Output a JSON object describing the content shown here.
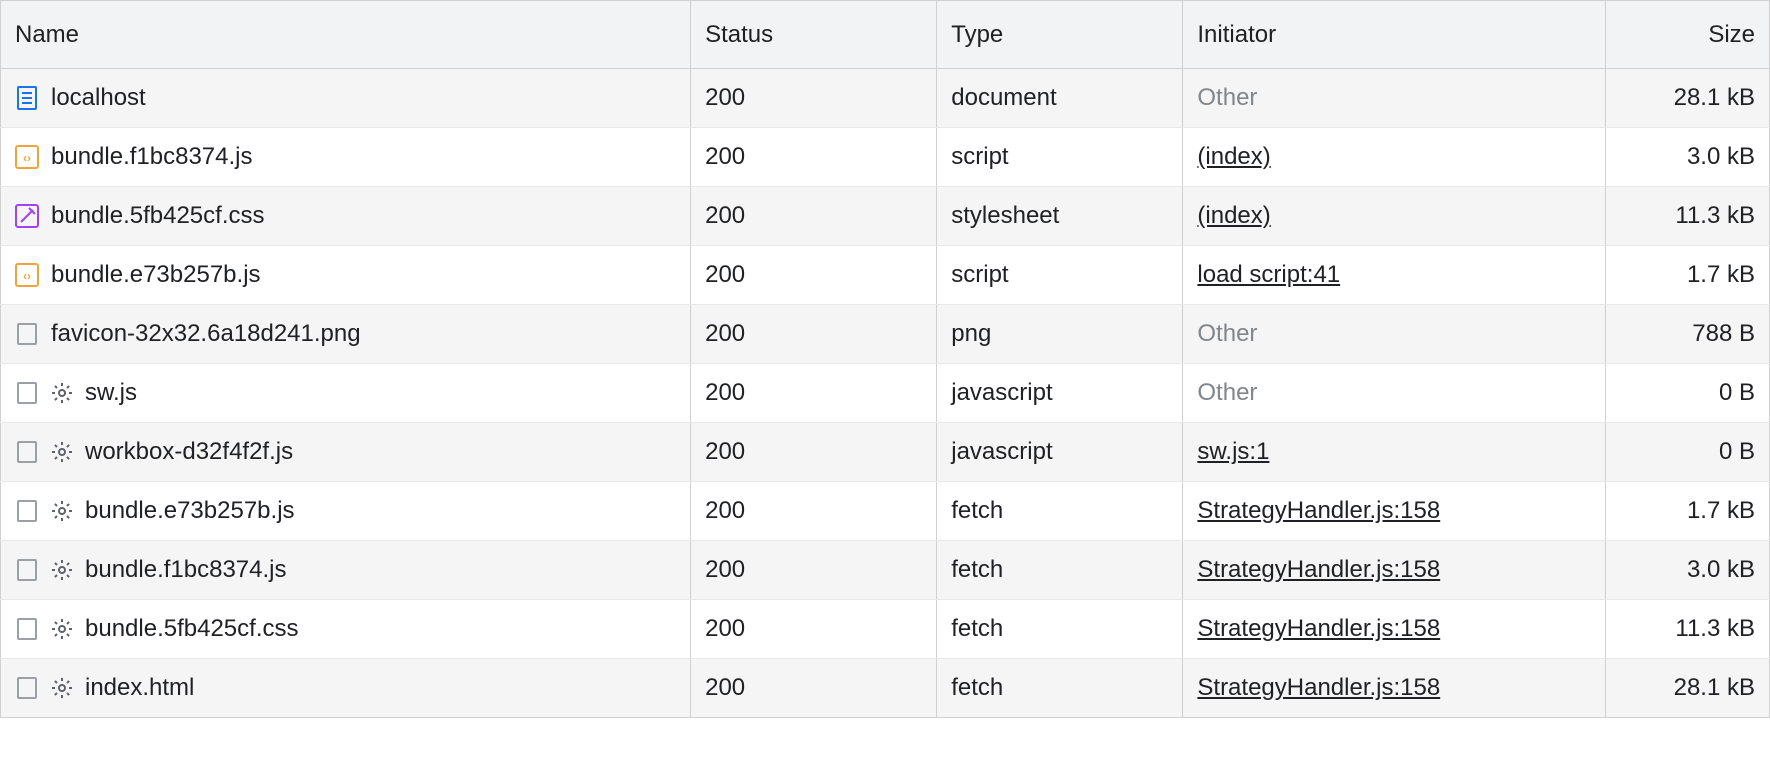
{
  "columns": {
    "name": "Name",
    "status": "Status",
    "type": "Type",
    "initiator": "Initiator",
    "size": "Size"
  },
  "rows": [
    {
      "icon": "document",
      "gear": false,
      "name": "localhost",
      "status": "200",
      "type": "document",
      "initiator": "Other",
      "initiator_link": false,
      "size": "28.1 kB"
    },
    {
      "icon": "js",
      "gear": false,
      "name": "bundle.f1bc8374.js",
      "status": "200",
      "type": "script",
      "initiator": "(index)",
      "initiator_link": true,
      "size": "3.0 kB"
    },
    {
      "icon": "css",
      "gear": false,
      "name": "bundle.5fb425cf.css",
      "status": "200",
      "type": "stylesheet",
      "initiator": "(index)",
      "initiator_link": true,
      "size": "11.3 kB"
    },
    {
      "icon": "js",
      "gear": false,
      "name": "bundle.e73b257b.js",
      "status": "200",
      "type": "script",
      "initiator": "load script:41",
      "initiator_link": true,
      "size": "1.7 kB"
    },
    {
      "icon": "generic",
      "gear": false,
      "name": "favicon-32x32.6a18d241.png",
      "status": "200",
      "type": "png",
      "initiator": "Other",
      "initiator_link": false,
      "size": "788 B"
    },
    {
      "icon": "generic",
      "gear": true,
      "name": "sw.js",
      "status": "200",
      "type": "javascript",
      "initiator": "Other",
      "initiator_link": false,
      "size": "0 B"
    },
    {
      "icon": "generic",
      "gear": true,
      "name": "workbox-d32f4f2f.js",
      "status": "200",
      "type": "javascript",
      "initiator": "sw.js:1",
      "initiator_link": true,
      "size": "0 B"
    },
    {
      "icon": "generic",
      "gear": true,
      "name": "bundle.e73b257b.js",
      "status": "200",
      "type": "fetch",
      "initiator": "StrategyHandler.js:158",
      "initiator_link": true,
      "size": "1.7 kB"
    },
    {
      "icon": "generic",
      "gear": true,
      "name": "bundle.f1bc8374.js",
      "status": "200",
      "type": "fetch",
      "initiator": "StrategyHandler.js:158",
      "initiator_link": true,
      "size": "3.0 kB"
    },
    {
      "icon": "generic",
      "gear": true,
      "name": "bundle.5fb425cf.css",
      "status": "200",
      "type": "fetch",
      "initiator": "StrategyHandler.js:158",
      "initiator_link": true,
      "size": "11.3 kB"
    },
    {
      "icon": "generic",
      "gear": true,
      "name": "index.html",
      "status": "200",
      "type": "fetch",
      "initiator": "StrategyHandler.js:158",
      "initiator_link": true,
      "size": "28.1 kB"
    }
  ]
}
